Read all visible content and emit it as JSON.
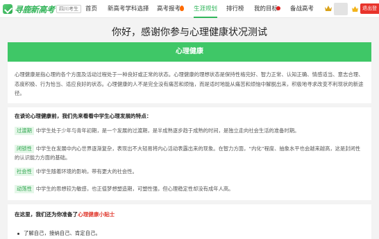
{
  "header": {
    "logo_text": "寻鹿新高考",
    "region": "四川考生",
    "nav": [
      {
        "label": "首页"
      },
      {
        "label": "新高考学科选择"
      },
      {
        "label": "高考报考"
      },
      {
        "label": "生涯规划"
      },
      {
        "label": "排行榜"
      },
      {
        "label": "我的目标"
      },
      {
        "label": "备战高考"
      }
    ],
    "logout_label": "退出登"
  },
  "page": {
    "title": "你好，感谢你参与心理健康状况测试",
    "card_title": "心理健康",
    "intro": "心理健康是指心理的各个方面及活动过程处于一种良好或正常的状态。心理健康的理想状态是保持性格完好、智力正常、认知正确、情感适当、意志合理、态度积极、行为恰当、适应良好的状态。心理健康的人不是完全没有痛苦和烦恼，而是适时地能从痛苦和烦恼中解脱出来，积极地寻求改变不利现状的新途径。",
    "traits_title": "在谈论心理健康前，我们先来看看中学生心理发展的特点：",
    "traits": [
      {
        "tag": "过渡期",
        "text": "中学生处于少年与青年初期，是一个发展的过渡期，是半成熟逐步趋于成熟的时间，是独立走向社会生活的准备时期。"
      },
      {
        "tag": "闭锁性",
        "text": "中学生在发展中内心世界逐渐复杂，表现出不大轻易将内心活动表露出来的现象。在智力方面，“内化”程度、抽象水平也会越来越高，这是封闭性的认识能力方面的基础。"
      },
      {
        "tag": "社会性",
        "text": "中学生随着环境的影响，带有更大的社会性。"
      },
      {
        "tag": "动荡性",
        "text": "中学生的思想较为敏感，也正值梦想塑造期，可塑性强，但心理稳定性却没有成年人高。"
      }
    ],
    "tips_prefix": "在这里，我们还为你准备了",
    "tips_highlight": "心理健康小贴士",
    "bullet": "了解自己，接纳自己、肯定自己。"
  },
  "colors": {
    "accent": "#3fc767",
    "logout": "#e8332b",
    "highlight": "#e03a2f"
  }
}
